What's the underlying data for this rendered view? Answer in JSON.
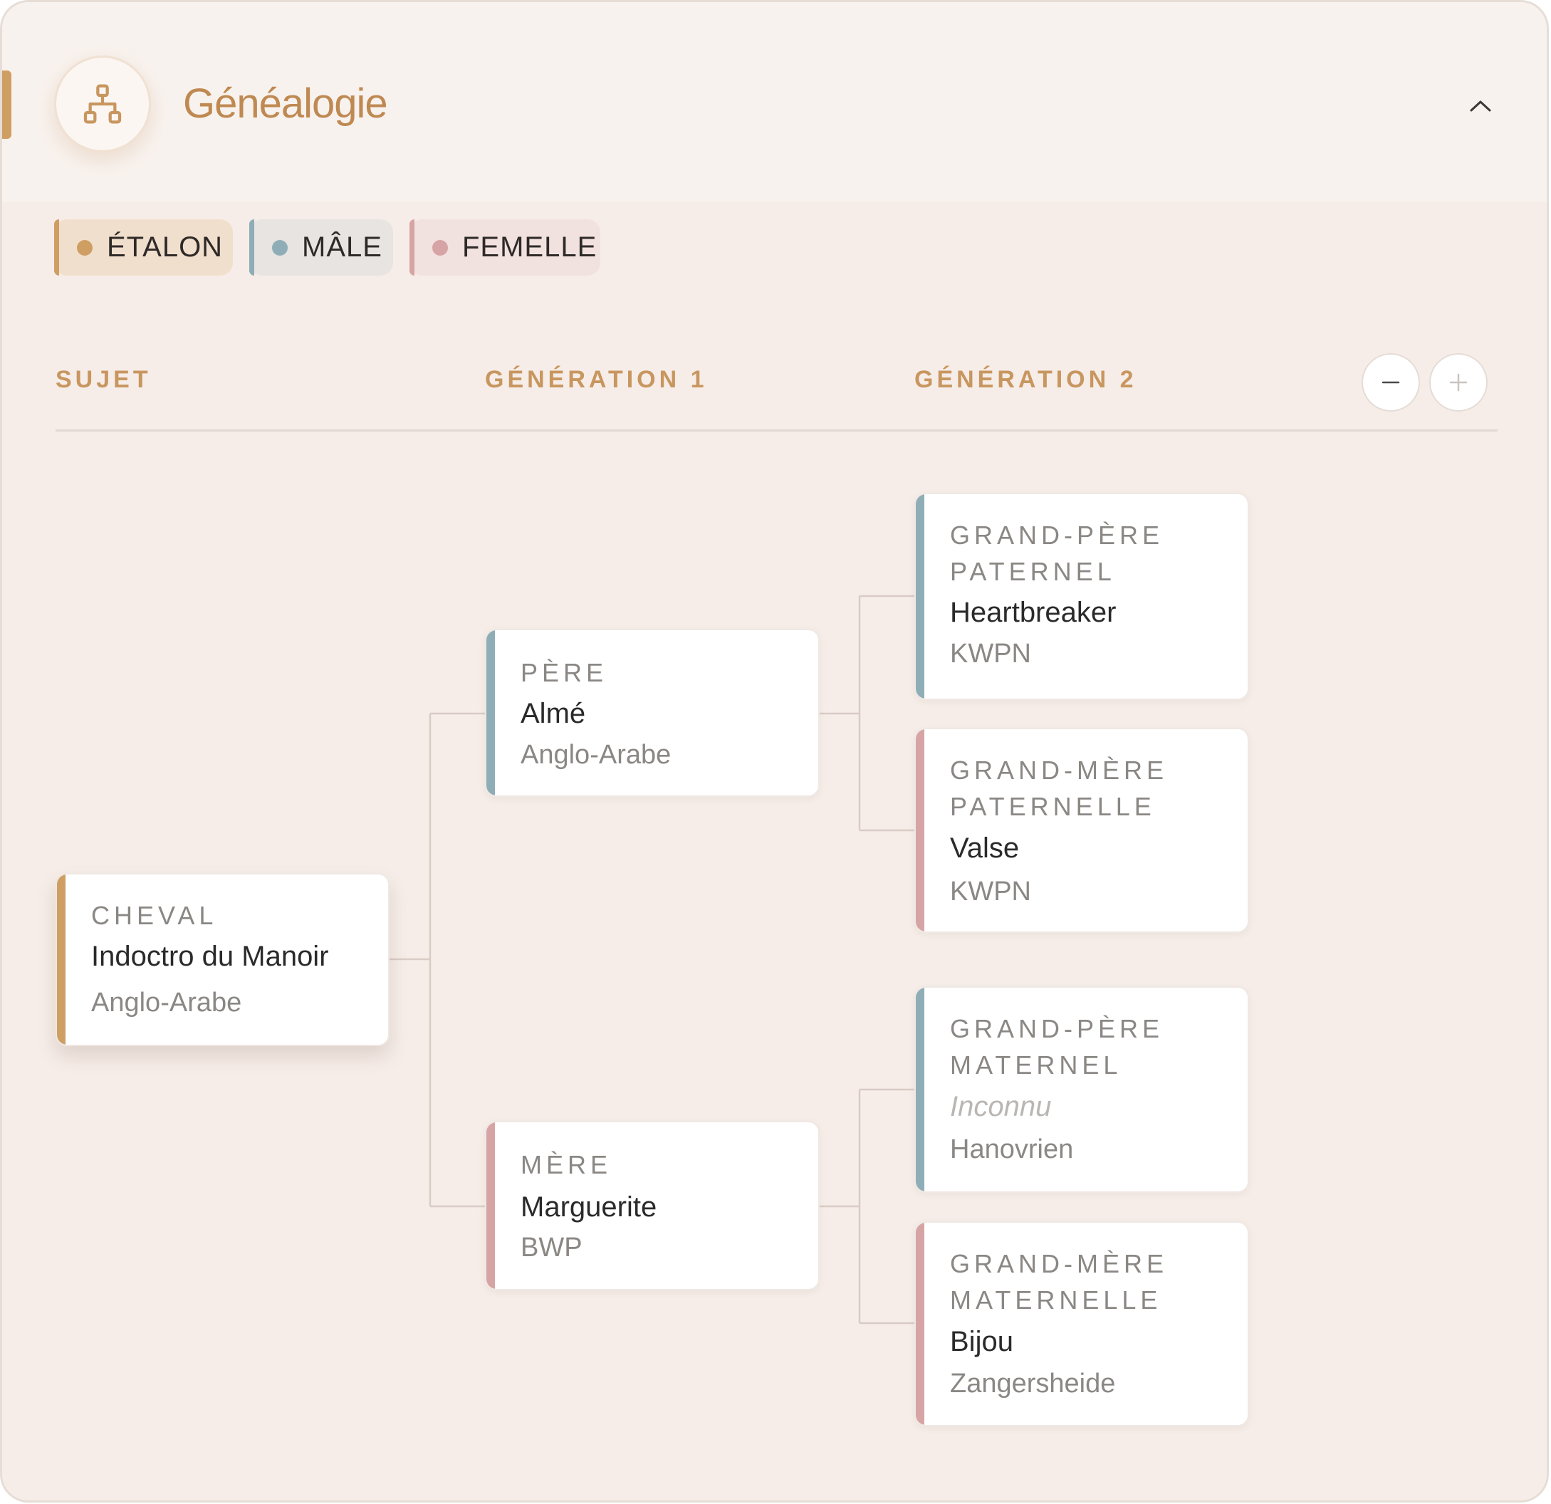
{
  "header": {
    "title": "Généalogie",
    "icon": "pedigree-tree-icon",
    "collapse_icon": "chevron-up-icon"
  },
  "legend": [
    {
      "label": "ÉTALON",
      "color": "#cf9e62"
    },
    {
      "label": "MÂLE",
      "color": "#8fadb6"
    },
    {
      "label": "FEMELLE",
      "color": "#d6a4a4"
    }
  ],
  "columns": {
    "sujet": "SUJET",
    "gen1": "GÉNÉRATION 1",
    "gen2": "GÉNÉRATION 2"
  },
  "controls": {
    "zoom_out": "−",
    "zoom_in": "+"
  },
  "subject": {
    "role": "CHEVAL",
    "name": "Indoctro du Manoir",
    "breed": "Anglo-Arabe",
    "color": "#cf9e62"
  },
  "gen1": {
    "father": {
      "role": "PÈRE",
      "name": "Almé",
      "breed": "Anglo-Arabe",
      "color": "#8fadb6"
    },
    "mother": {
      "role": "MÈRE",
      "name": "Marguerite",
      "breed": "BWP",
      "color": "#d6a4a4"
    }
  },
  "gen2": {
    "paternal_grandfather": {
      "role_line1": "GRAND-PÈRE",
      "role_line2": "PATERNEL",
      "name": "Heartbreaker",
      "breed": "KWPN",
      "color": "#8fadb6"
    },
    "paternal_grandmother": {
      "role_line1": "GRAND-MÈRE",
      "role_line2": "PATERNELLE",
      "name": "Valse",
      "breed": "KWPN",
      "color": "#d6a4a4"
    },
    "maternal_grandfather": {
      "role_line1": "GRAND-PÈRE",
      "role_line2": "MATERNEL",
      "name": "Inconnu",
      "breed": "Hanovrien",
      "color": "#8fadb6"
    },
    "maternal_grandmother": {
      "role_line1": "GRAND-MÈRE",
      "role_line2": "MATERNELLE",
      "name": "Bijou",
      "breed": "Zangersheide",
      "color": "#d6a4a4"
    }
  }
}
